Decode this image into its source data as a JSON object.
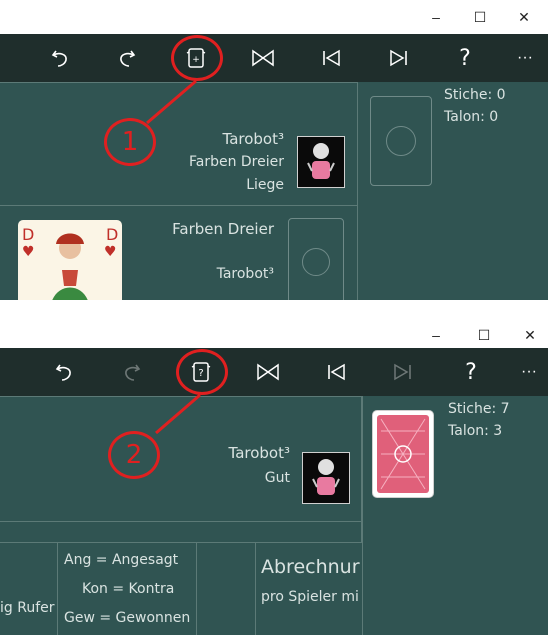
{
  "window_controls": {
    "minimize": "–",
    "maximize": "☐",
    "close": "✕"
  },
  "toolbar": {
    "more_label": "···",
    "help_label": "?"
  },
  "screenshot_1": {
    "opponent": {
      "name": "Tarobot³",
      "game": "Farben Dreier",
      "status": "Liege"
    },
    "stats": {
      "stiche": "Stiche: 0",
      "talon": "Talon: 0"
    },
    "trick_area": {
      "game": "Farben Dreier",
      "player": "Tarobot³"
    },
    "callout": "1"
  },
  "screenshot_2": {
    "opponent": {
      "name": "Tarobot³",
      "status": "Gut"
    },
    "stats": {
      "stiche": "Stiche: 7",
      "talon": "Talon: 3"
    },
    "scoring": {
      "left_fragment": "ig Rufer",
      "legend": [
        "Ang = Angesagt",
        "Kon = Kontra",
        "Gew = Gewonnen"
      ],
      "heading": "Abrechnur",
      "subheading": "pro Spieler mi"
    },
    "callout": "2"
  },
  "colors": {
    "felt": "#305452",
    "toolbar": "#1f2e2c",
    "callout": "#e02020"
  }
}
